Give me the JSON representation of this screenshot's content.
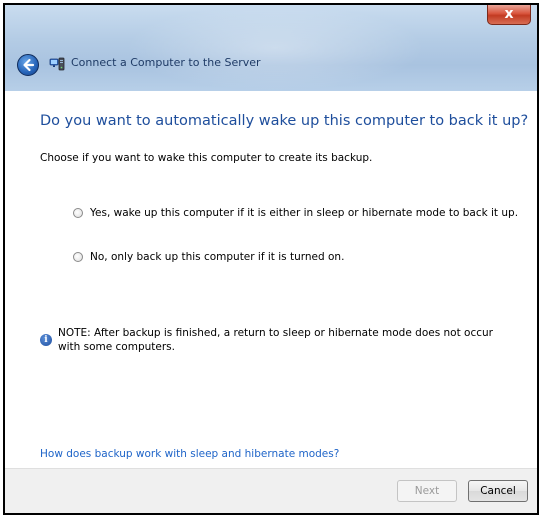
{
  "window": {
    "title": "Connect a Computer to the Server",
    "close_label": "x"
  },
  "page": {
    "heading": "Do you want to automatically wake up this computer to back it up?",
    "description": "Choose if you want to wake this computer to create its backup.",
    "options": [
      {
        "label": "Yes, wake up this computer if it is either in sleep or hibernate mode to back it up.",
        "selected": false
      },
      {
        "label": "No, only back up this computer if it is turned on.",
        "selected": false
      }
    ],
    "note": "NOTE: After backup is finished, a return to sleep or hibernate mode does not occur with some computers.",
    "help_link": "How does backup work with sleep and hibernate modes?"
  },
  "footer": {
    "next_label": "Next",
    "cancel_label": "Cancel"
  },
  "icons": {
    "back": "back-arrow-icon",
    "app": "computer-server-icon",
    "info": "info-icon",
    "close": "close-icon"
  },
  "colors": {
    "heading": "#1e4e9c",
    "link": "#1e64c8",
    "close_button": "#c23b22",
    "titlebar": "#b4cce5"
  }
}
